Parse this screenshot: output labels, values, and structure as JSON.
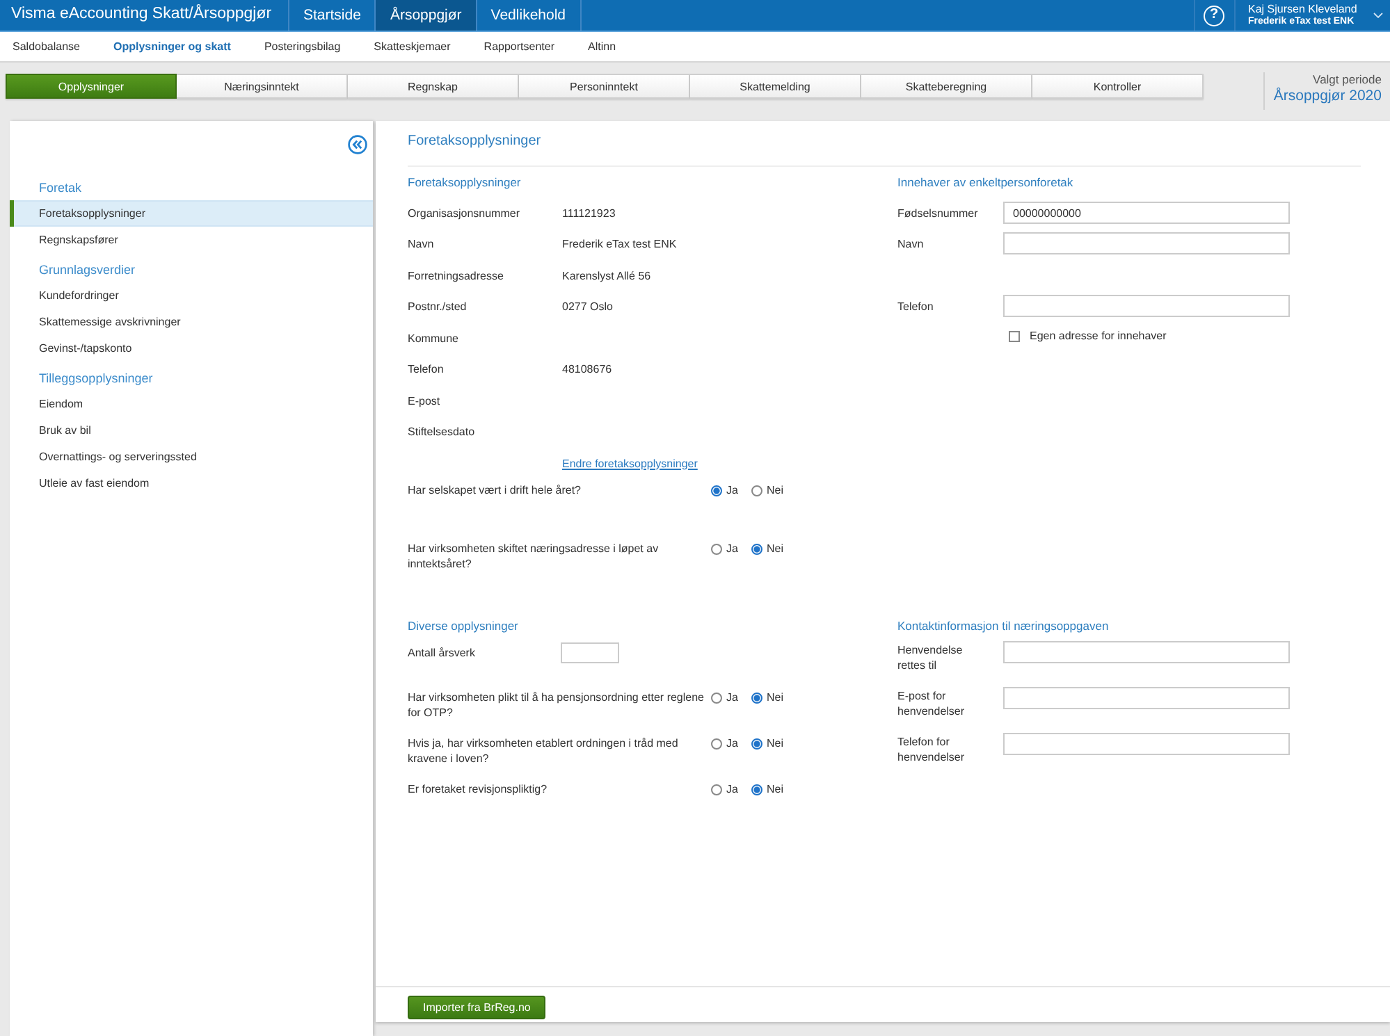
{
  "app_bar": {
    "title": "Visma eAccounting Skatt/Årsoppgjør",
    "nav": [
      {
        "label": "Startside",
        "selected": false
      },
      {
        "label": "Årsoppgjør",
        "selected": true
      },
      {
        "label": "Vedlikehold",
        "selected": false
      }
    ],
    "help": "?",
    "user": {
      "name": "Kaj Sjursen Kleveland",
      "company": "Frederik eTax test ENK"
    }
  },
  "sub_nav": [
    {
      "label": "Saldobalanse",
      "selected": false
    },
    {
      "label": "Opplysninger og skatt",
      "selected": true
    },
    {
      "label": "Posteringsbilag",
      "selected": false
    },
    {
      "label": "Skatteskjemaer",
      "selected": false
    },
    {
      "label": "Rapportsenter",
      "selected": false
    },
    {
      "label": "Altinn",
      "selected": false
    }
  ],
  "tabs": [
    {
      "label": "Opplysninger",
      "selected": true
    },
    {
      "label": "Næringsinntekt",
      "selected": false
    },
    {
      "label": "Regnskap",
      "selected": false
    },
    {
      "label": "Personinntekt",
      "selected": false
    },
    {
      "label": "Skattemelding",
      "selected": false
    },
    {
      "label": "Skatteberegning",
      "selected": false
    },
    {
      "label": "Kontroller",
      "selected": false
    }
  ],
  "period": {
    "label": "Valgt periode",
    "value": "Årsoppgjør 2020"
  },
  "sidebar": {
    "groups": [
      {
        "title": "Foretak",
        "items": [
          {
            "label": "Foretaksopplysninger",
            "selected": true
          },
          {
            "label": "Regnskapsfører",
            "selected": false
          }
        ]
      },
      {
        "title": "Grunnlagsverdier",
        "items": [
          {
            "label": "Kundefordringer",
            "selected": false
          },
          {
            "label": "Skattemessige avskrivninger",
            "selected": false
          },
          {
            "label": "Gevinst-/tapskonto",
            "selected": false
          }
        ]
      },
      {
        "title": "Tilleggsopplysninger",
        "items": [
          {
            "label": "Eiendom",
            "selected": false
          },
          {
            "label": "Bruk av bil",
            "selected": false
          },
          {
            "label": "Overnattings- og serveringssted",
            "selected": false
          },
          {
            "label": "Utleie av fast eiendom",
            "selected": false
          }
        ]
      }
    ]
  },
  "page": {
    "title": "Foretaksopplysninger",
    "company": {
      "title": "Foretaksopplysninger",
      "fields": [
        {
          "label": "Organisasjonsnummer",
          "value": "111121923"
        },
        {
          "label": "Navn",
          "value": "Frederik eTax test ENK"
        },
        {
          "label": "Forretningsadresse",
          "value": "Karenslyst Allé 56"
        },
        {
          "label": "Postnr./sted",
          "value": "0277 Oslo"
        },
        {
          "label": "Kommune"
        },
        {
          "label": "Telefon",
          "value": "48108676"
        },
        {
          "label": "E-post"
        },
        {
          "label": "Stiftelsesdato"
        }
      ],
      "link": "Endre foretaksopplysninger",
      "questions": [
        {
          "text": "Har selskapet vært i drift hele året?",
          "options": [
            {
              "label": "Ja",
              "selected": true
            },
            {
              "label": "Nei",
              "selected": false
            }
          ]
        },
        {
          "text": "Har virksomheten skiftet næringsadresse i løpet av inntektsåret?",
          "options": [
            {
              "label": "Ja",
              "selected": false
            },
            {
              "label": "Nei",
              "selected": true
            }
          ]
        }
      ]
    },
    "owner": {
      "title": "Innehaver av enkeltpersonforetak",
      "fields": [
        {
          "label": "Fødselsnummer",
          "value": "00000000000"
        },
        {
          "label": "Navn"
        },
        {
          "label": "Telefon"
        }
      ],
      "checkbox": {
        "label": "Egen adresse for innehaver",
        "checked": false
      }
    },
    "misc": {
      "title": "Diverse opplysninger",
      "fields": [
        {
          "label": "Antall årsverk"
        }
      ],
      "questions": [
        {
          "text": "Har virksomheten plikt til å ha pensjonsordning etter reglene for OTP?",
          "options": [
            {
              "label": "Ja",
              "selected": false
            },
            {
              "label": "Nei",
              "selected": true
            }
          ]
        },
        {
          "text": "Hvis ja, har virksomheten etablert ordningen i tråd med kravene i loven?",
          "options": [
            {
              "label": "Ja",
              "selected": false
            },
            {
              "label": "Nei",
              "selected": true
            }
          ]
        },
        {
          "text": "Er foretaket revisjonspliktig?",
          "options": [
            {
              "label": "Ja",
              "selected": false
            },
            {
              "label": "Nei",
              "selected": true
            }
          ]
        }
      ]
    },
    "contact": {
      "title": "Kontaktinformasjon til næringsoppgaven",
      "fields": [
        {
          "label": "Henvendelse rettes til"
        },
        {
          "label": "E-post for henvendelser"
        },
        {
          "label": "Telefon for henvendelser"
        }
      ]
    },
    "import_button": "Importer fra BrReg.no"
  }
}
